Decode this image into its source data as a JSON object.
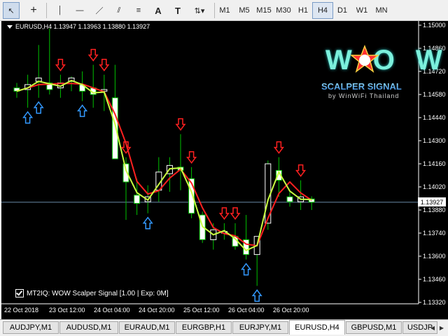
{
  "toolbar": {
    "tools": [
      {
        "name": "cursor-tool",
        "glyph": "↖"
      },
      {
        "name": "crosshair-tool",
        "glyph": "+"
      },
      {
        "name": "vertical-line-tool",
        "glyph": "│"
      },
      {
        "name": "horizontal-line-tool",
        "glyph": "—"
      },
      {
        "name": "trendline-tool",
        "glyph": "／"
      },
      {
        "name": "equidistant-channel-tool",
        "glyph": "⫽"
      },
      {
        "name": "fibonacci-tool",
        "glyph": "≡"
      },
      {
        "name": "text-tool",
        "glyph": "A"
      },
      {
        "name": "text-label-tool",
        "glyph": "T"
      },
      {
        "name": "arrows-tool",
        "glyph": "⇅▾"
      }
    ],
    "timeframes": [
      "M1",
      "M5",
      "M15",
      "M30",
      "H1",
      "H4",
      "D1",
      "W1",
      "MN"
    ],
    "active_timeframe": "H4"
  },
  "chart": {
    "header": "EURUSD,H4  1.13947 1.13963 1.13880 1.13927",
    "price_ticks": [
      "1.15000",
      "1.14860",
      "1.14720",
      "1.14580",
      "1.14440",
      "1.14300",
      "1.14160",
      "1.14020",
      "1.13880",
      "1.13740",
      "1.13600",
      "1.13460",
      "1.13320"
    ],
    "current_price": "1.13927",
    "time_ticks": [
      "22 Oct 2018",
      "23 Oct 12:00",
      "24 Oct 04:00",
      "24 Oct 20:00",
      "25 Oct 12:00",
      "26 Oct 04:00",
      "26 Oct 20:00"
    ],
    "signal_label": "MT2IQ: WOW Scalper Signal [1.00 | Exp: 0M]",
    "logo": {
      "wow": "WOW",
      "scalper": "SCALPER SIGNAL",
      "by": "by WinWiFi Thailand"
    },
    "colors": {
      "bull": "#ffffff",
      "bear": "#ffffff",
      "wick": "#00c000",
      "ma_red": "#ff2020",
      "ma_yellow": "#c8ff40",
      "arrow_up": "#3399ff",
      "arrow_down": "#ff2020",
      "current_line": "#6a8aa8"
    }
  },
  "chart_data": {
    "type": "candlestick",
    "symbol": "EURUSD",
    "timeframe": "H4",
    "ylim": [
      1.1332,
      1.15
    ],
    "candles": [
      {
        "o": 1.1462,
        "h": 1.1465,
        "l": 1.1456,
        "c": 1.146
      },
      {
        "o": 1.1461,
        "h": 1.147,
        "l": 1.145,
        "c": 1.1464
      },
      {
        "o": 1.1466,
        "h": 1.1488,
        "l": 1.1456,
        "c": 1.1468
      },
      {
        "o": 1.1465,
        "h": 1.1498,
        "l": 1.1458,
        "c": 1.1461
      },
      {
        "o": 1.1462,
        "h": 1.147,
        "l": 1.1456,
        "c": 1.1465
      },
      {
        "o": 1.1466,
        "h": 1.1469,
        "l": 1.146,
        "c": 1.1468
      },
      {
        "o": 1.1464,
        "h": 1.1472,
        "l": 1.1454,
        "c": 1.146
      },
      {
        "o": 1.1462,
        "h": 1.1476,
        "l": 1.145,
        "c": 1.1458
      },
      {
        "o": 1.146,
        "h": 1.147,
        "l": 1.1448,
        "c": 1.1461
      },
      {
        "o": 1.1456,
        "h": 1.1476,
        "l": 1.144,
        "c": 1.1419
      },
      {
        "o": 1.1416,
        "h": 1.142,
        "l": 1.1382,
        "c": 1.1405
      },
      {
        "o": 1.1397,
        "h": 1.1407,
        "l": 1.1385,
        "c": 1.1392
      },
      {
        "o": 1.1393,
        "h": 1.1403,
        "l": 1.1386,
        "c": 1.1396
      },
      {
        "o": 1.14,
        "h": 1.142,
        "l": 1.1393,
        "c": 1.1411
      },
      {
        "o": 1.141,
        "h": 1.142,
        "l": 1.1399,
        "c": 1.1415
      },
      {
        "o": 1.1414,
        "h": 1.1434,
        "l": 1.14,
        "c": 1.1412
      },
      {
        "o": 1.1407,
        "h": 1.1414,
        "l": 1.1383,
        "c": 1.1386
      },
      {
        "o": 1.1385,
        "h": 1.1387,
        "l": 1.1368,
        "c": 1.137
      },
      {
        "o": 1.137,
        "h": 1.138,
        "l": 1.1364,
        "c": 1.1376
      },
      {
        "o": 1.1374,
        "h": 1.138,
        "l": 1.137,
        "c": 1.1375
      },
      {
        "o": 1.1372,
        "h": 1.138,
        "l": 1.1364,
        "c": 1.1366
      },
      {
        "o": 1.137,
        "h": 1.1385,
        "l": 1.1358,
        "c": 1.1361
      },
      {
        "o": 1.1361,
        "h": 1.1372,
        "l": 1.1342,
        "c": 1.1372
      },
      {
        "o": 1.138,
        "h": 1.1418,
        "l": 1.1376,
        "c": 1.1416
      },
      {
        "o": 1.1412,
        "h": 1.142,
        "l": 1.1396,
        "c": 1.1406
      },
      {
        "o": 1.1396,
        "h": 1.14,
        "l": 1.139,
        "c": 1.1393
      },
      {
        "o": 1.1393,
        "h": 1.1406,
        "l": 1.1388,
        "c": 1.1396
      },
      {
        "o": 1.13947,
        "h": 1.13963,
        "l": 1.1388,
        "c": 1.13927
      }
    ],
    "buy_signals": [
      1,
      2,
      6,
      12,
      21,
      22
    ],
    "sell_signals": [
      4,
      7,
      8,
      10,
      15,
      16,
      19,
      20,
      24,
      26
    ]
  },
  "tabs": {
    "items": [
      "AUDJPY,M1",
      "AUDUSD,M1",
      "EURAUD,M1",
      "EURGBP,H1",
      "EURJPY,M1",
      "EURUSD,H4",
      "GBPUSD,M1",
      "USDJP"
    ],
    "active": "EURUSD,H4"
  }
}
